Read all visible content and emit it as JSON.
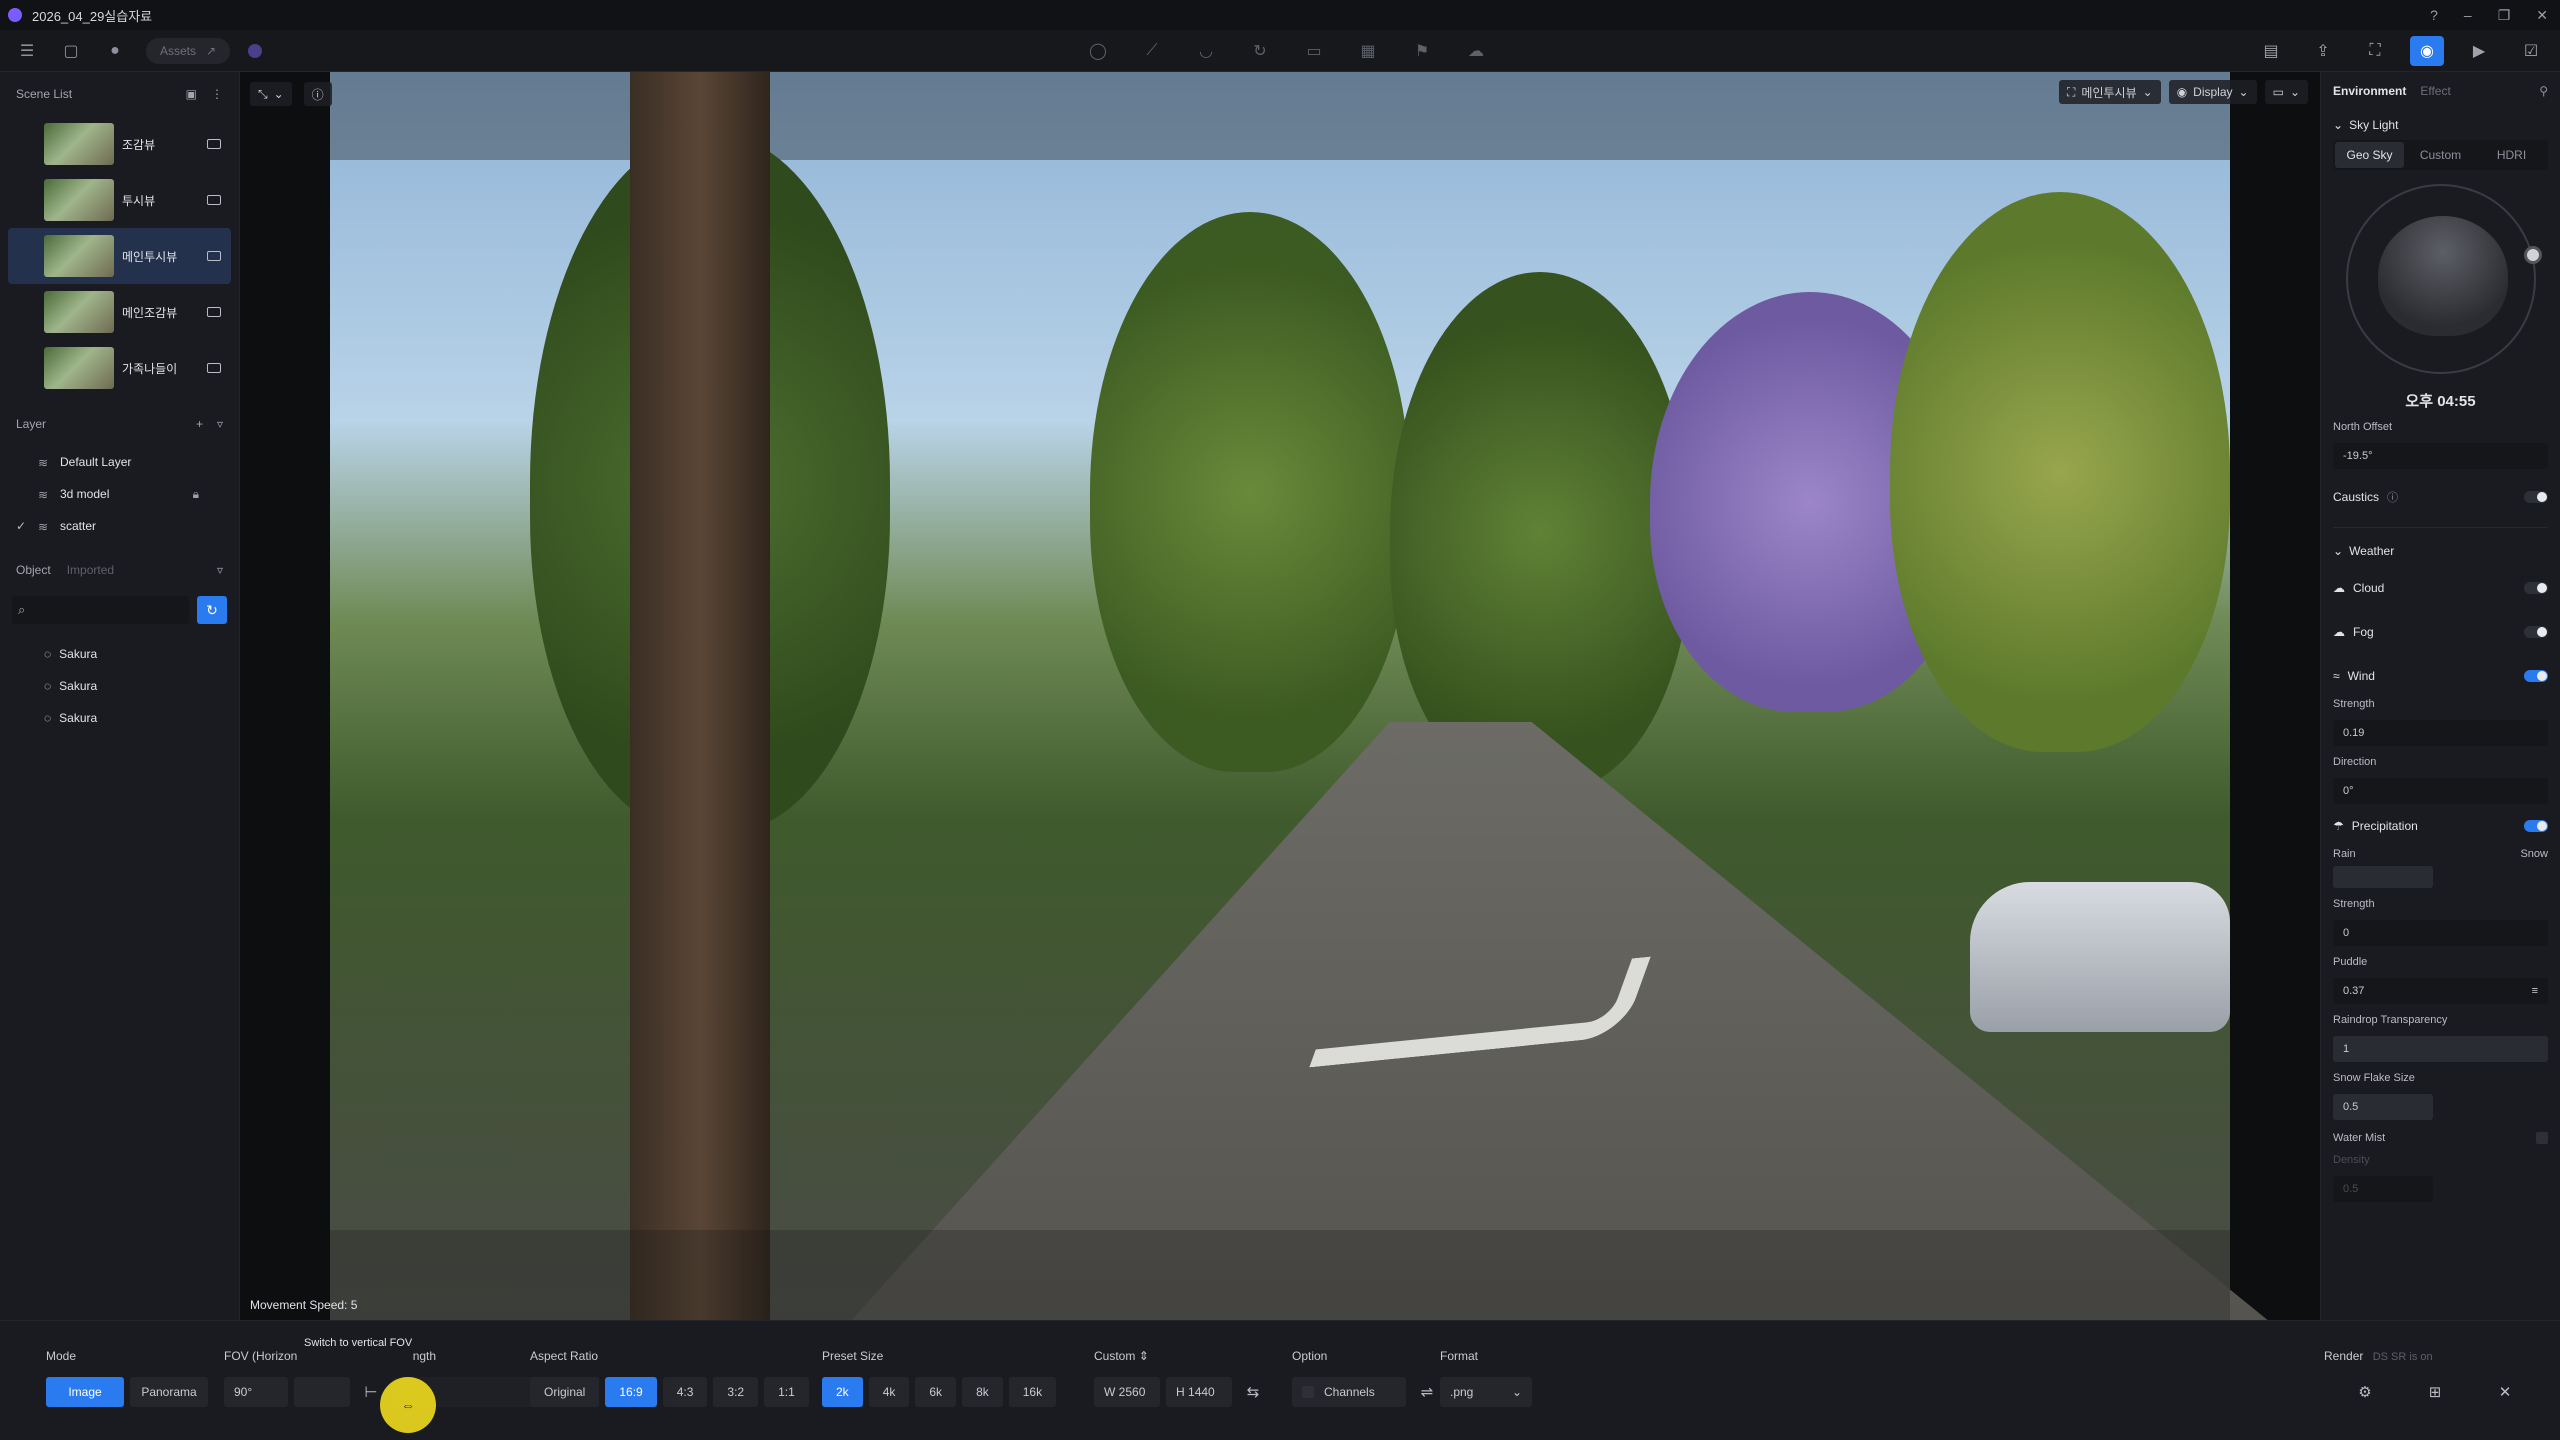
{
  "window": {
    "title": "2026_04_29실습자료"
  },
  "toolbar": {
    "assets_label": "Assets"
  },
  "scene_list": {
    "title": "Scene List",
    "items": [
      {
        "label": "조감뷰"
      },
      {
        "label": "투시뷰"
      },
      {
        "label": "메인투시뷰"
      },
      {
        "label": "메인조감뷰"
      },
      {
        "label": "가족나들이"
      }
    ]
  },
  "layers": {
    "title": "Layer",
    "items": [
      {
        "label": "Default Layer"
      },
      {
        "label": "3d model"
      },
      {
        "label": "scatter"
      }
    ]
  },
  "objects": {
    "tab_object": "Object",
    "tab_imported": "Imported",
    "items": [
      {
        "label": "Sakura"
      },
      {
        "label": "Sakura"
      },
      {
        "label": "Sakura"
      }
    ]
  },
  "viewport": {
    "camera_label": "메인투시뷰",
    "display_label": "Display",
    "movement_speed": "Movement Speed: 5"
  },
  "right_panel": {
    "tab_environment": "Environment",
    "tab_effect": "Effect",
    "sky_light": "Sky Light",
    "sky_modes": [
      "Geo Sky",
      "Custom",
      "HDRI"
    ],
    "time": "오후 04:55",
    "north_offset_label": "North Offset",
    "north_offset_value": "-19.5°",
    "caustics_label": "Caustics",
    "weather_label": "Weather",
    "cloud_label": "Cloud",
    "fog_label": "Fog",
    "wind_label": "Wind",
    "wind_strength_label": "Strength",
    "wind_strength_value": "0.19",
    "direction_label": "Direction",
    "direction_value": "0°",
    "precip_label": "Precipitation",
    "rain_label": "Rain",
    "snow_label": "Snow",
    "precip_strength_label": "Strength",
    "precip_strength_value": "0",
    "puddle_label": "Puddle",
    "puddle_value": "0.37",
    "raindrop_label": "Raindrop Transparency",
    "raindrop_value": "1",
    "snowflake_label": "Snow Flake Size",
    "snowflake_value": "0.5",
    "water_mist_label": "Water Mist",
    "density_label": "Density",
    "density_value": "0.5"
  },
  "bottom": {
    "mode_label": "Mode",
    "mode_image": "Image",
    "mode_panorama": "Panorama",
    "fov_label": "FOV (Horizon",
    "fov_label_tail": "ngth",
    "fov_value": "90°",
    "tooltip": "Switch to vertical FOV",
    "aspect_label": "Aspect Ratio",
    "aspect_options": [
      "Original",
      "16:9",
      "4:3",
      "3:2",
      "1:1"
    ],
    "preset_label": "Preset Size",
    "preset_options": [
      "2k",
      "4k",
      "6k",
      "8k",
      "16k"
    ],
    "custom_label": "Custom",
    "width_prefix": "W",
    "width_value": "2560",
    "height_prefix": "H",
    "height_value": "1440",
    "option_label": "Option",
    "channels_label": "Channels",
    "format_label": "Format",
    "format_value": ".png",
    "render_label": "Render",
    "render_note": "DS SR is on"
  }
}
